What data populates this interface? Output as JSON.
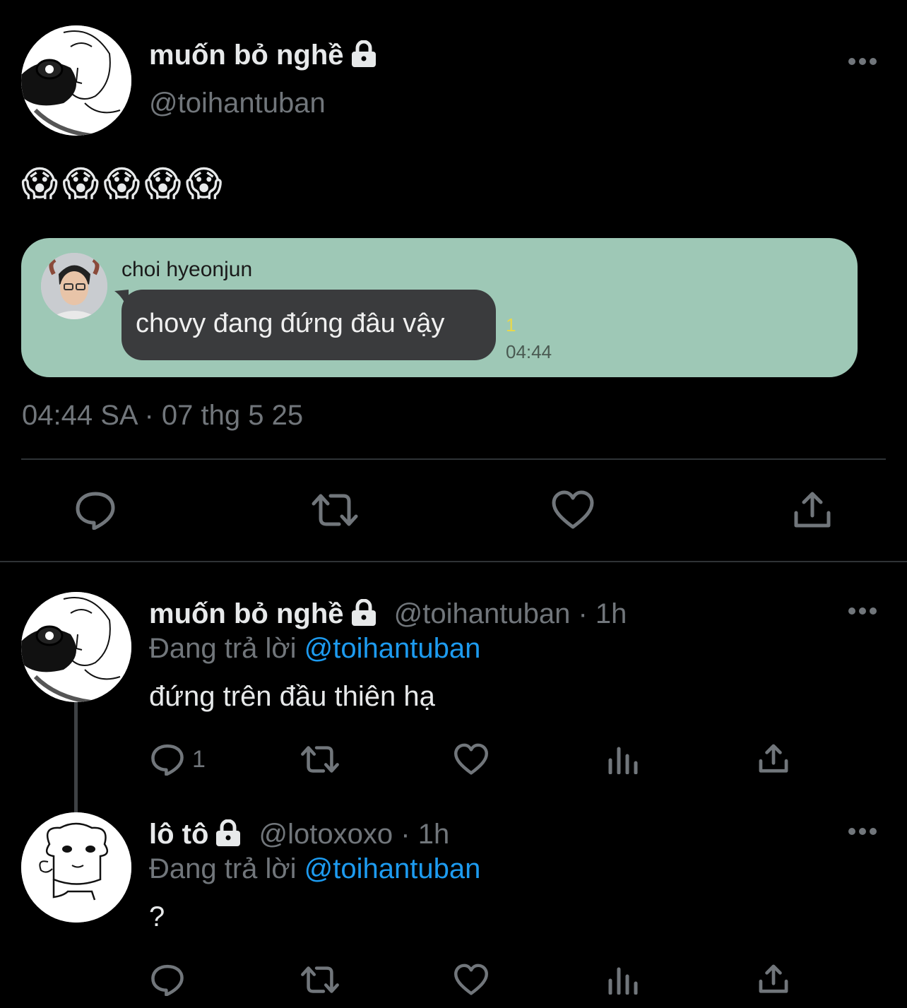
{
  "main_tweet": {
    "display_name": "muốn bỏ nghề",
    "handle": "@toihantuban",
    "emoji_text": "😱😱😱😱😱",
    "timestamp": "04:44 SA · 07 thg 5 25",
    "embedded_chat": {
      "sender": "choi hyeonjun",
      "message": "chovy đang đứng đâu vậy",
      "read_count": "1",
      "time": "04:44",
      "background": "#9ec8b6",
      "bubble": "#3a3b3d"
    }
  },
  "replies": [
    {
      "display_name": "muốn bỏ nghề",
      "handle": "@toihantuban",
      "age": "· 1h",
      "replying_prefix": "Đang trả lời",
      "replying_to": "@toihantuban",
      "text": "đứng trên đầu thiên hạ",
      "reply_count": "1"
    },
    {
      "display_name": "lô tô",
      "handle": "@lotoxoxo",
      "age": "· 1h",
      "replying_prefix": "Đang trả lời",
      "replying_to": "@toihantuban",
      "text": "?",
      "reply_count": ""
    }
  ],
  "colors": {
    "background": "#000000",
    "text": "#e7e9ea",
    "muted": "#71767b",
    "link": "#1d9bf0",
    "divider": "#2f3336",
    "read_count": "#e8d84a"
  },
  "icons": [
    "reply-icon",
    "retweet-icon",
    "like-icon",
    "share-icon",
    "views-icon",
    "lock-icon",
    "more-icon"
  ]
}
